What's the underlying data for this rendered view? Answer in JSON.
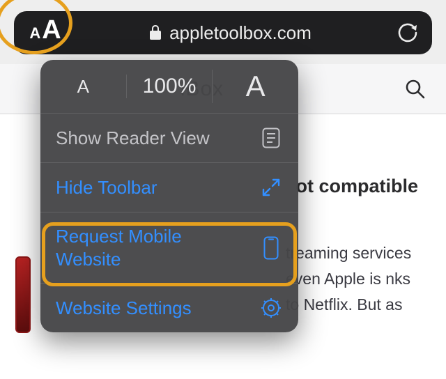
{
  "urlbar": {
    "aa_small": "A",
    "aa_large": "A",
    "domain": "appletoolbox.com"
  },
  "sitebar": {
    "brand_visible": "lBox"
  },
  "article": {
    "headline_visible": "ot compatible",
    "paragraph_visible": "treaming services even Apple is nks to Netflix. But as"
  },
  "menu": {
    "text_smaller": "A",
    "zoom": "100%",
    "text_larger": "A",
    "reader": "Show Reader View",
    "hide_toolbar": "Hide Toolbar",
    "request_mobile": "Request Mobile Website",
    "website_settings": "Website Settings"
  },
  "colors": {
    "highlight": "#e6a01e",
    "link_blue": "#338fff",
    "menu_bg": "#464648"
  }
}
